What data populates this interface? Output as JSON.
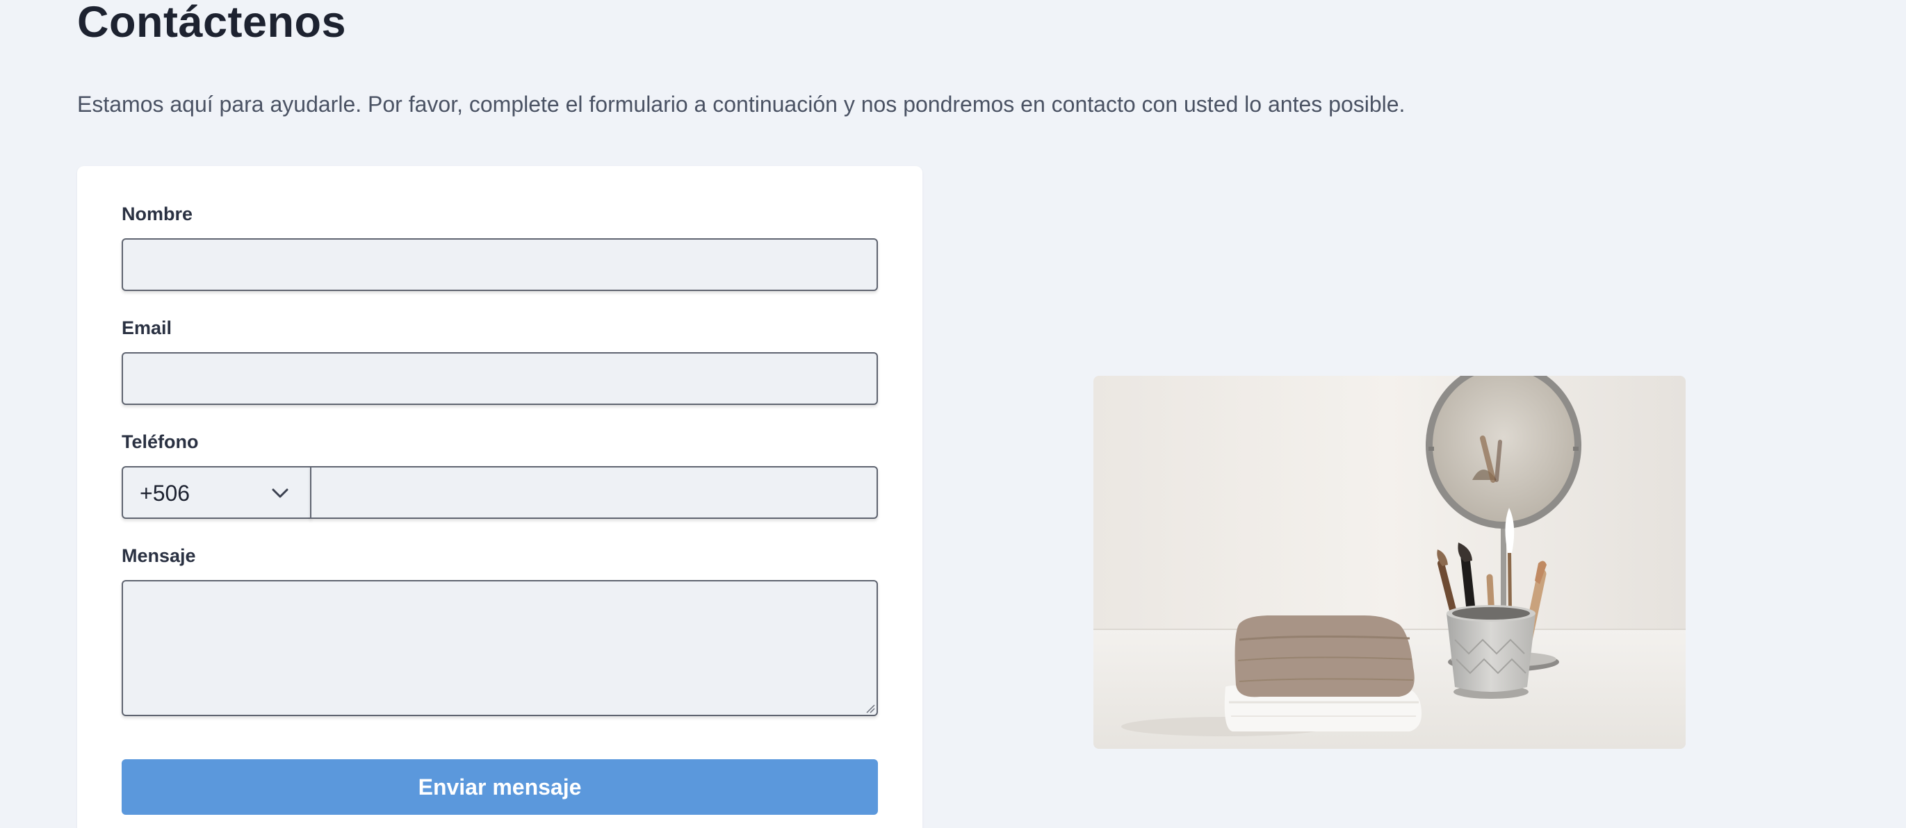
{
  "page": {
    "title": "Contáctenos",
    "subtitle": "Estamos aquí para ayudarle. Por favor, complete el formulario a continuación y nos pondremos en contacto con usted lo antes posible."
  },
  "form": {
    "name": {
      "label": "Nombre",
      "value": ""
    },
    "email": {
      "label": "Email",
      "value": ""
    },
    "phone": {
      "label": "Teléfono",
      "country_code": "+506",
      "value": ""
    },
    "message": {
      "label": "Mensaje",
      "value": ""
    },
    "submit_label": "Enviar mensaje"
  },
  "image": {
    "subject": "folded towels, makeup brushes in a cup and a round vanity mirror"
  },
  "colors": {
    "page_background": "#f0f3f8",
    "card_background": "#ffffff",
    "field_background": "#eef1f5",
    "field_border": "#5f6470",
    "button_background": "#5b98dc",
    "button_text": "#ffffff",
    "title_text": "#1d2230",
    "subtitle_text": "#4a5263"
  },
  "icons": {
    "country_dropdown": "chevron-down-icon",
    "textarea_resize": "resize-grip-icon"
  }
}
